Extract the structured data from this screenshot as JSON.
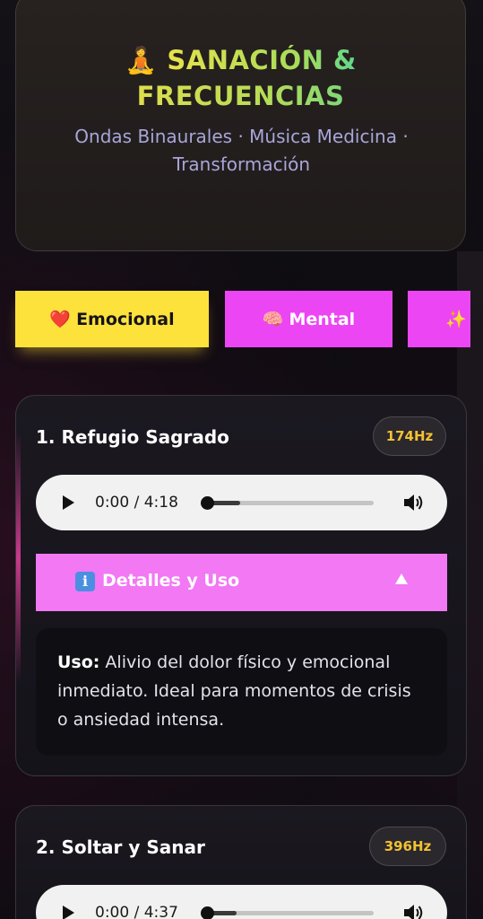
{
  "header": {
    "icon": "🧘",
    "title_line1": "SANACIÓN &",
    "title_line2": "FRECUENCIAS",
    "subtitle": "Ondas Binaurales · Música Medicina · Transformación",
    "title_gradient": [
      "#e8e24a",
      "#5fd88e"
    ],
    "subtitle_color": "#a9a5d9"
  },
  "tabs": [
    {
      "icon": "❤️",
      "label": "Emocional",
      "active": true,
      "color": "#fde23c"
    },
    {
      "icon": "🧠",
      "label": "Mental",
      "active": false,
      "color": "#ec45f3"
    },
    {
      "icon": "✨",
      "label": "",
      "active": false,
      "color": "#ec45f3"
    }
  ],
  "tracks": [
    {
      "title": "1. Refugio Sagrado",
      "frequency": "174Hz",
      "player": {
        "current": "0:00",
        "duration": "4:18",
        "time_text": "0:00 / 4:18",
        "progress": 0.0
      },
      "details": {
        "button_label": "Detalles y Uso",
        "expanded": true,
        "uso_label": "Uso:",
        "uso_text": " Alivio del dolor físico y emocional inmediato. Ideal para momentos de crisis o ansiedad intensa."
      }
    },
    {
      "title": "2. Soltar y Sanar",
      "frequency": "396Hz",
      "player": {
        "current": "0:00",
        "duration": "4:37",
        "time_text": "0:00 / 4:37",
        "progress": 0.0
      }
    }
  ],
  "colors": {
    "accent_pink": "#ec45f3",
    "details_bar": "#f278f4",
    "active_tab": "#fde23c",
    "frequency_text": "#f2c232"
  }
}
